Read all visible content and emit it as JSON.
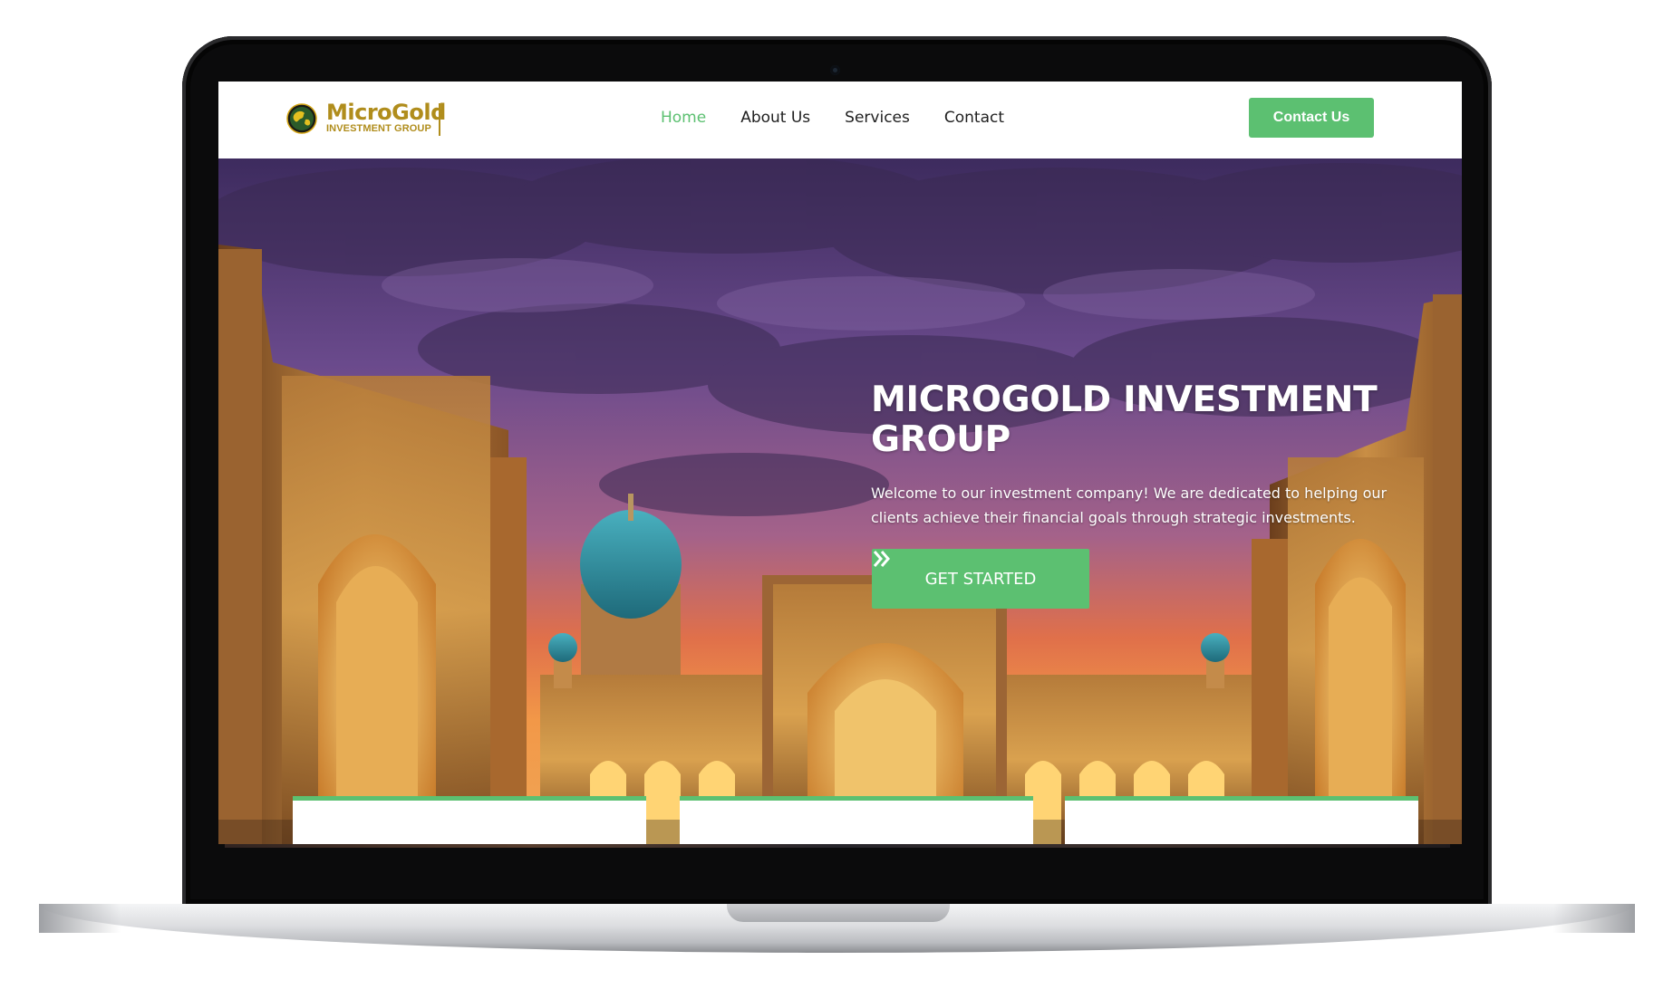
{
  "brand": {
    "name": "MicroGold",
    "tagline": "INVESTMENT GROUP"
  },
  "nav": {
    "items": [
      {
        "label": "Home",
        "active": true
      },
      {
        "label": "About Us",
        "active": false
      },
      {
        "label": "Services",
        "active": false
      },
      {
        "label": "Contact",
        "active": false
      }
    ],
    "cta_label": "Contact Us"
  },
  "hero": {
    "title": "MICROGOLD INVESTMENT GROUP",
    "text": "Welcome to our investment company! We are dedicated to helping our clients achieve their financial goals through strategic investments.",
    "button_label": "GET STARTED",
    "button_icon": "double-chevron-right-icon"
  },
  "colors": {
    "accent": "#5cc071",
    "brand_gold": "#b08d1c",
    "nav_text": "#1f1f1f"
  }
}
